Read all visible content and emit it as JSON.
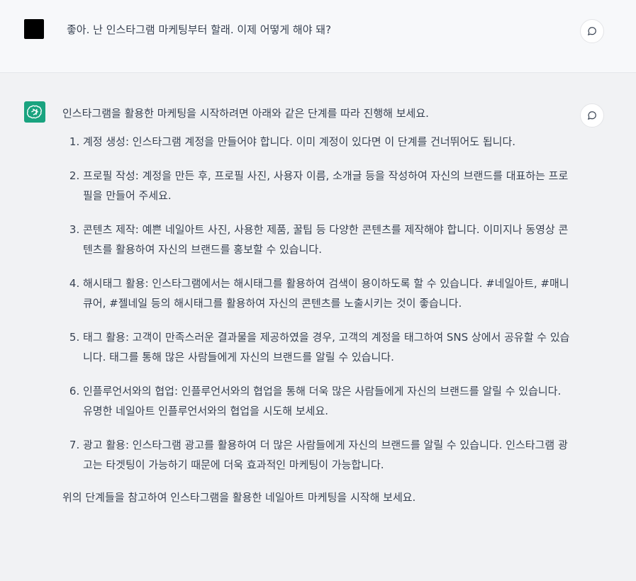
{
  "user_message": {
    "text": "좋아. 난 인스타그램 마케팅부터 할래. 이제 어떻게 해야 돼?",
    "feedback_icon": "message-bubble-icon"
  },
  "assistant_message": {
    "intro": "인스타그램을 활용한 마케팅을 시작하려면 아래와 같은 단계를 따라 진행해 보세요.",
    "steps": [
      "계정 생성: 인스타그램 계정을 만들어야 합니다. 이미 계정이 있다면 이 단계를 건너뛰어도 됩니다.",
      "프로필 작성: 계정을 만든 후, 프로필 사진, 사용자 이름, 소개글 등을 작성하여 자신의 브랜드를 대표하는 프로필을 만들어 주세요.",
      "콘텐츠 제작: 예쁜 네일아트 사진, 사용한 제품, 꿀팁 등 다양한 콘텐츠를 제작해야 합니다. 이미지나 동영상 콘텐츠를 활용하여 자신의 브랜드를 홍보할 수 있습니다.",
      "해시태그 활용: 인스타그램에서는 해시태그를 활용하여 검색이 용이하도록 할 수 있습니다. #네일아트, #매니큐어, #젤네일 등의 해시태그를 활용하여 자신의 콘텐츠를 노출시키는 것이 좋습니다.",
      "태그 활용: 고객이 만족스러운 결과물을 제공하였을 경우, 고객의 계정을 태그하여 SNS 상에서 공유할 수 있습니다. 태그를 통해 많은 사람들에게 자신의 브랜드를 알릴 수 있습니다.",
      "인플루언서와의 협업: 인플루언서와의 협업을 통해 더욱 많은 사람들에게 자신의 브랜드를 알릴 수 있습니다. 유명한 네일아트 인플루언서와의 협업을 시도해 보세요.",
      "광고 활용: 인스타그램 광고를 활용하여 더 많은 사람들에게 자신의 브랜드를 알릴 수 있습니다. 인스타그램 광고는 타겟팅이 가능하기 때문에 더욱 효과적인 마케팅이 가능합니다."
    ],
    "closing": "위의 단계들을 참고하여 인스타그램을 활용한 네일아트 마케팅을 시작해 보세요.",
    "feedback_icon": "message-bubble-icon"
  },
  "colors": {
    "user_bg": "#f7f8fa",
    "assistant_bg": "#f1f2f4",
    "ai_avatar": "#19a37f",
    "text": "#374151"
  }
}
